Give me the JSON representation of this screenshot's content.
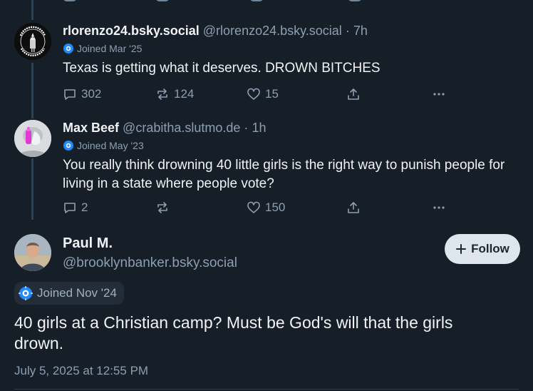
{
  "posts": [
    {
      "display_name": "rlorenzo24.bsky.social",
      "handle": "@rlorenzo24.bsky.social",
      "separator": "·",
      "time": "7h",
      "joined": "Joined Mar '25",
      "avatar_text": "RACIST LIVES DON'T MATTER",
      "text": "Texas is getting what it deserves. DROWN BITCHES",
      "replies": "302",
      "reposts": "124",
      "likes": "15"
    },
    {
      "display_name": "Max Beef",
      "handle": "@crabitha.slutmo.de",
      "separator": "·",
      "time": "1h",
      "joined": "Joined May '23",
      "text": "You really think drowning 40 little girls is the right way to punish people for living in a state where people vote?",
      "replies": "2",
      "reposts": "",
      "likes": "150"
    }
  ],
  "main_post": {
    "display_name": "Paul M.",
    "handle": "@brooklynbanker.bsky.social",
    "follow_label": "Follow",
    "joined": "Joined Nov '24",
    "text": "40 girls at a Christian camp? Must be God's will that the girls drown.",
    "timestamp": "July 5, 2025 at 12:55 PM"
  },
  "icons": {
    "reply": "reply-icon",
    "repost": "repost-icon",
    "like": "heart-icon",
    "share": "share-icon",
    "more": "more-icon",
    "joined": "new-user-icon",
    "follow": "plus-icon"
  },
  "colors": {
    "background": "#161e27",
    "text": "#f1f3f5",
    "muted": "#8d9fb2",
    "accent": "#208bfe",
    "follow_bg": "#dfe5ec"
  }
}
